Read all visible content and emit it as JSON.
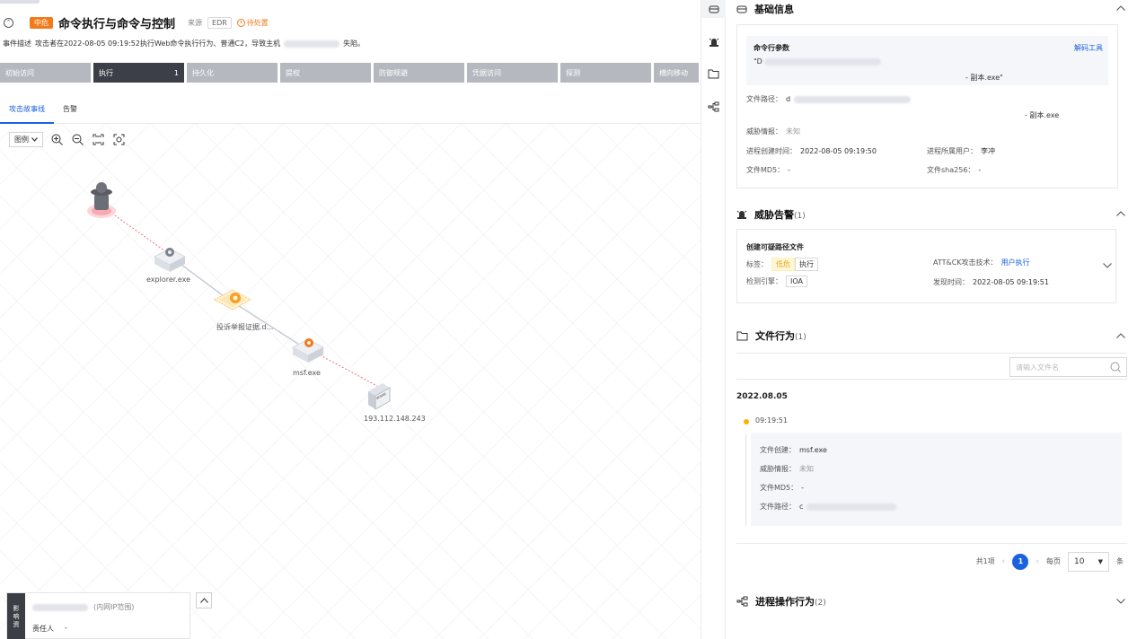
{
  "event": {
    "severity": "中危",
    "title": "命令执行与命令与控制",
    "source_label": "来源",
    "source_value": "EDR",
    "status": "待处置",
    "desc_label": "事件描述",
    "desc_text_before": "攻击者在2022-08-05 09:19:52执行Web命令执行行为、普通C2，导致主机",
    "desc_text_after": "失陷。"
  },
  "stages": [
    {
      "label": "初始访问",
      "count": ""
    },
    {
      "label": "执行",
      "count": "1"
    },
    {
      "label": "持久化",
      "count": ""
    },
    {
      "label": "提权",
      "count": ""
    },
    {
      "label": "防御规避",
      "count": ""
    },
    {
      "label": "凭据访问",
      "count": ""
    },
    {
      "label": "探测",
      "count": ""
    },
    {
      "label": "横向移动",
      "count": ""
    }
  ],
  "tabs": {
    "story": "攻击故事线",
    "alerts": "告警"
  },
  "graph": {
    "legend_label": "图例",
    "nodes": {
      "explorer": "explorer.exe",
      "doc": "投诉举报证据.d...",
      "msf": "msf.exe",
      "ip": "193.112.148.243"
    }
  },
  "impact": {
    "side_label": [
      "影",
      "响",
      "资"
    ],
    "scope": "(内网IP范围)",
    "owner_label": "责任人",
    "owner_value": "-"
  },
  "basic": {
    "title": "基础信息",
    "cmd_title": "命令行参数",
    "decode_label": "解码工具",
    "cmd_prefix": "\"D",
    "cmd_suffix": "- 副本.exe\"",
    "file_path_label": "文件路径：",
    "file_path_prefix": "d",
    "file_path_suffix": "- 副本.exe",
    "threat_intel_label": "威胁情报：",
    "threat_intel_value": "未知",
    "proc_time_label": "进程创建时间：",
    "proc_time_value": "2022-08-05 09:19:50",
    "proc_user_label": "进程所属用户：",
    "proc_user_value": "李冲",
    "md5_label": "文件MD5：",
    "md5_value": "-",
    "sha_label": "文件sha256：",
    "sha_value": "-"
  },
  "threat_alert": {
    "title": "威胁告警",
    "count": "(1)",
    "name": "创建可疑路径文件",
    "tag_label": "标签：",
    "tag_level": "低危",
    "tag_stage": "执行",
    "attck_label": "ATT&CK攻击技术：",
    "attck_value": "用户执行",
    "engine_label": "检测引擎：",
    "engine_value": "IOA",
    "found_label": "发现时间：",
    "found_value": "2022-08-05 09:19:51"
  },
  "file_behavior": {
    "title": "文件行为",
    "count": "(1)",
    "search_placeholder": "请输入文件名",
    "date": "2022.08.05",
    "time": "09:19:51",
    "create_label": "文件创建：",
    "create_value": "msf.exe",
    "intel_label": "威胁情报：",
    "intel_value": "未知",
    "md5_label": "文件MD5：",
    "md5_value": "-",
    "path_label": "文件路径：",
    "path_prefix": "c"
  },
  "pagination": {
    "total": "共1项",
    "current": "1",
    "per_page_label": "每页",
    "per_page": "10",
    "unit": "条"
  },
  "process_ops": {
    "title": "进程操作行为",
    "count": "(2)"
  },
  "colors": {
    "accent": "#1a62e0",
    "severity": "#f27a1a",
    "stage_active": "#3c3f47",
    "stage": "#b5b8bf",
    "timeline_dot": "#f5b400"
  }
}
